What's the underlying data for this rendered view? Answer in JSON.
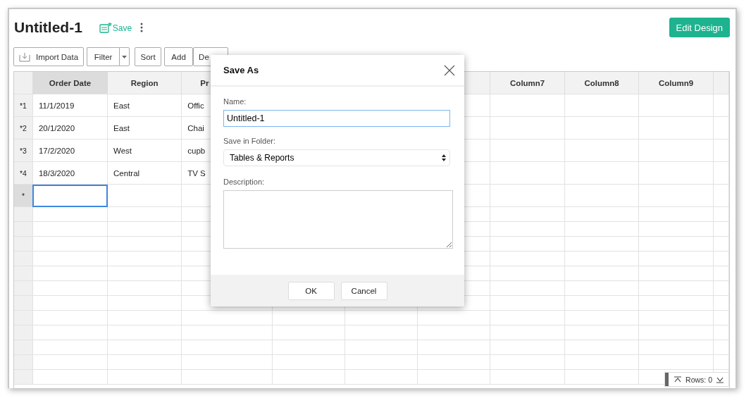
{
  "title": "Untitled-1",
  "save_label": "Save",
  "edit_button": "Edit Design",
  "toolbar": [
    {
      "kind": "import",
      "label": "Import Data"
    },
    {
      "kind": "split",
      "label": "Filter"
    },
    {
      "kind": "plain",
      "label": "Sort"
    },
    {
      "kind": "group",
      "label": "Add"
    },
    {
      "kind": "group",
      "label": "De"
    }
  ],
  "table": {
    "columns": [
      {
        "label": "Order Date",
        "selected": true
      },
      {
        "label": "Region",
        "selected": false
      },
      {
        "label": "Pr",
        "selected": false
      },
      {},
      {},
      {},
      {
        "label": "Column7",
        "selected": false
      },
      {
        "label": "Column8",
        "selected": false
      },
      {
        "label": "Column9",
        "selected": false
      }
    ],
    "rows": [
      {
        "marker": "*1",
        "cells": [
          "11/1/2019",
          "East",
          "Offic"
        ]
      },
      {
        "marker": "*2",
        "cells": [
          "20/1/2020",
          "East",
          "Chai"
        ]
      },
      {
        "marker": "*3",
        "cells": [
          "17/2/2020",
          "West",
          "cupb"
        ]
      },
      {
        "marker": "*4",
        "cells": [
          "18/3/2020",
          "Central",
          "TV S"
        ]
      }
    ],
    "new_row": {
      "marker": "*",
      "selected": true
    }
  },
  "rows_status": "Rows: 0",
  "dialog": {
    "title": "Save As",
    "name_label": "Name:",
    "name_value": "Untitled-1",
    "folder_label": "Save in Folder:",
    "folder_value": "Tables & Reports",
    "description_label": "Description:",
    "buttons": [
      "OK",
      "Cancel"
    ]
  }
}
